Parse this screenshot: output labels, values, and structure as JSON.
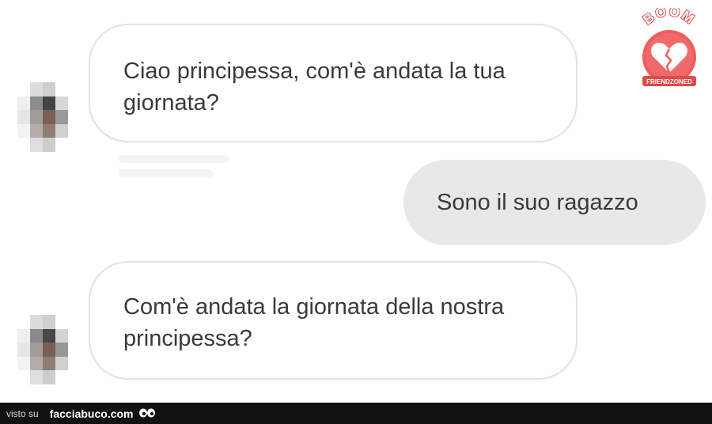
{
  "conversation": {
    "messages": [
      {
        "direction": "incoming",
        "text": "Ciao principessa, com'è andata la tua giornata?"
      },
      {
        "direction": "outgoing",
        "text": "Sono il suo ragazzo"
      },
      {
        "direction": "incoming",
        "text": "Com'è andata la giornata della nostra principessa?"
      }
    ],
    "avatar_icon": "pixelated-avatar-icon"
  },
  "watermark": {
    "badge_text_top": "BOOM",
    "badge_text_bottom": "FRIENDZONED",
    "icon": "broken-heart-icon",
    "color": "#e04a4a"
  },
  "footer": {
    "prefix": "visto su",
    "site": "facciabuco.com",
    "icon": "eyes-icon"
  },
  "colors": {
    "incoming_bubble": "#ffffff",
    "outgoing_bubble": "#e8e8e8",
    "text": "#3a3a3a",
    "footer_bg": "#111111"
  }
}
